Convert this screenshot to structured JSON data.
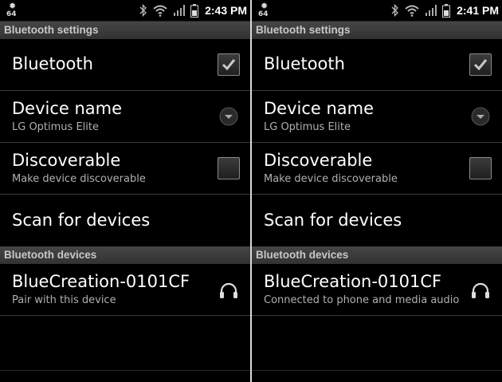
{
  "panels": [
    {
      "status_bar": {
        "notif_number": "64",
        "time": "2:43 PM"
      },
      "header": "Bluetooth settings",
      "items": {
        "bluetooth": {
          "title": "Bluetooth",
          "checked": true
        },
        "device_name": {
          "title": "Device name",
          "subtitle": "LG Optimus Elite"
        },
        "discoverable": {
          "title": "Discoverable",
          "subtitle": "Make device discoverable",
          "checked": false
        },
        "scan": {
          "title": "Scan for devices"
        }
      },
      "devices_header": "Bluetooth devices",
      "devices": [
        {
          "name": "BlueCreation-0101CF",
          "status": "Pair with this device",
          "icon": "headphones-icon"
        }
      ]
    },
    {
      "status_bar": {
        "notif_number": "64",
        "time": "2:41 PM"
      },
      "header": "Bluetooth settings",
      "items": {
        "bluetooth": {
          "title": "Bluetooth",
          "checked": true
        },
        "device_name": {
          "title": "Device name",
          "subtitle": "LG Optimus Elite"
        },
        "discoverable": {
          "title": "Discoverable",
          "subtitle": "Make device discoverable",
          "checked": false
        },
        "scan": {
          "title": "Scan for devices"
        }
      },
      "devices_header": "Bluetooth devices",
      "devices": [
        {
          "name": "BlueCreation-0101CF",
          "status": "Connected to phone and media audio",
          "icon": "headphones-icon"
        }
      ]
    }
  ],
  "colors": {
    "background": "#000000",
    "section_header": "#3a3a3a",
    "divider": "#d9d9d9",
    "subtext": "#b0b0b0"
  }
}
